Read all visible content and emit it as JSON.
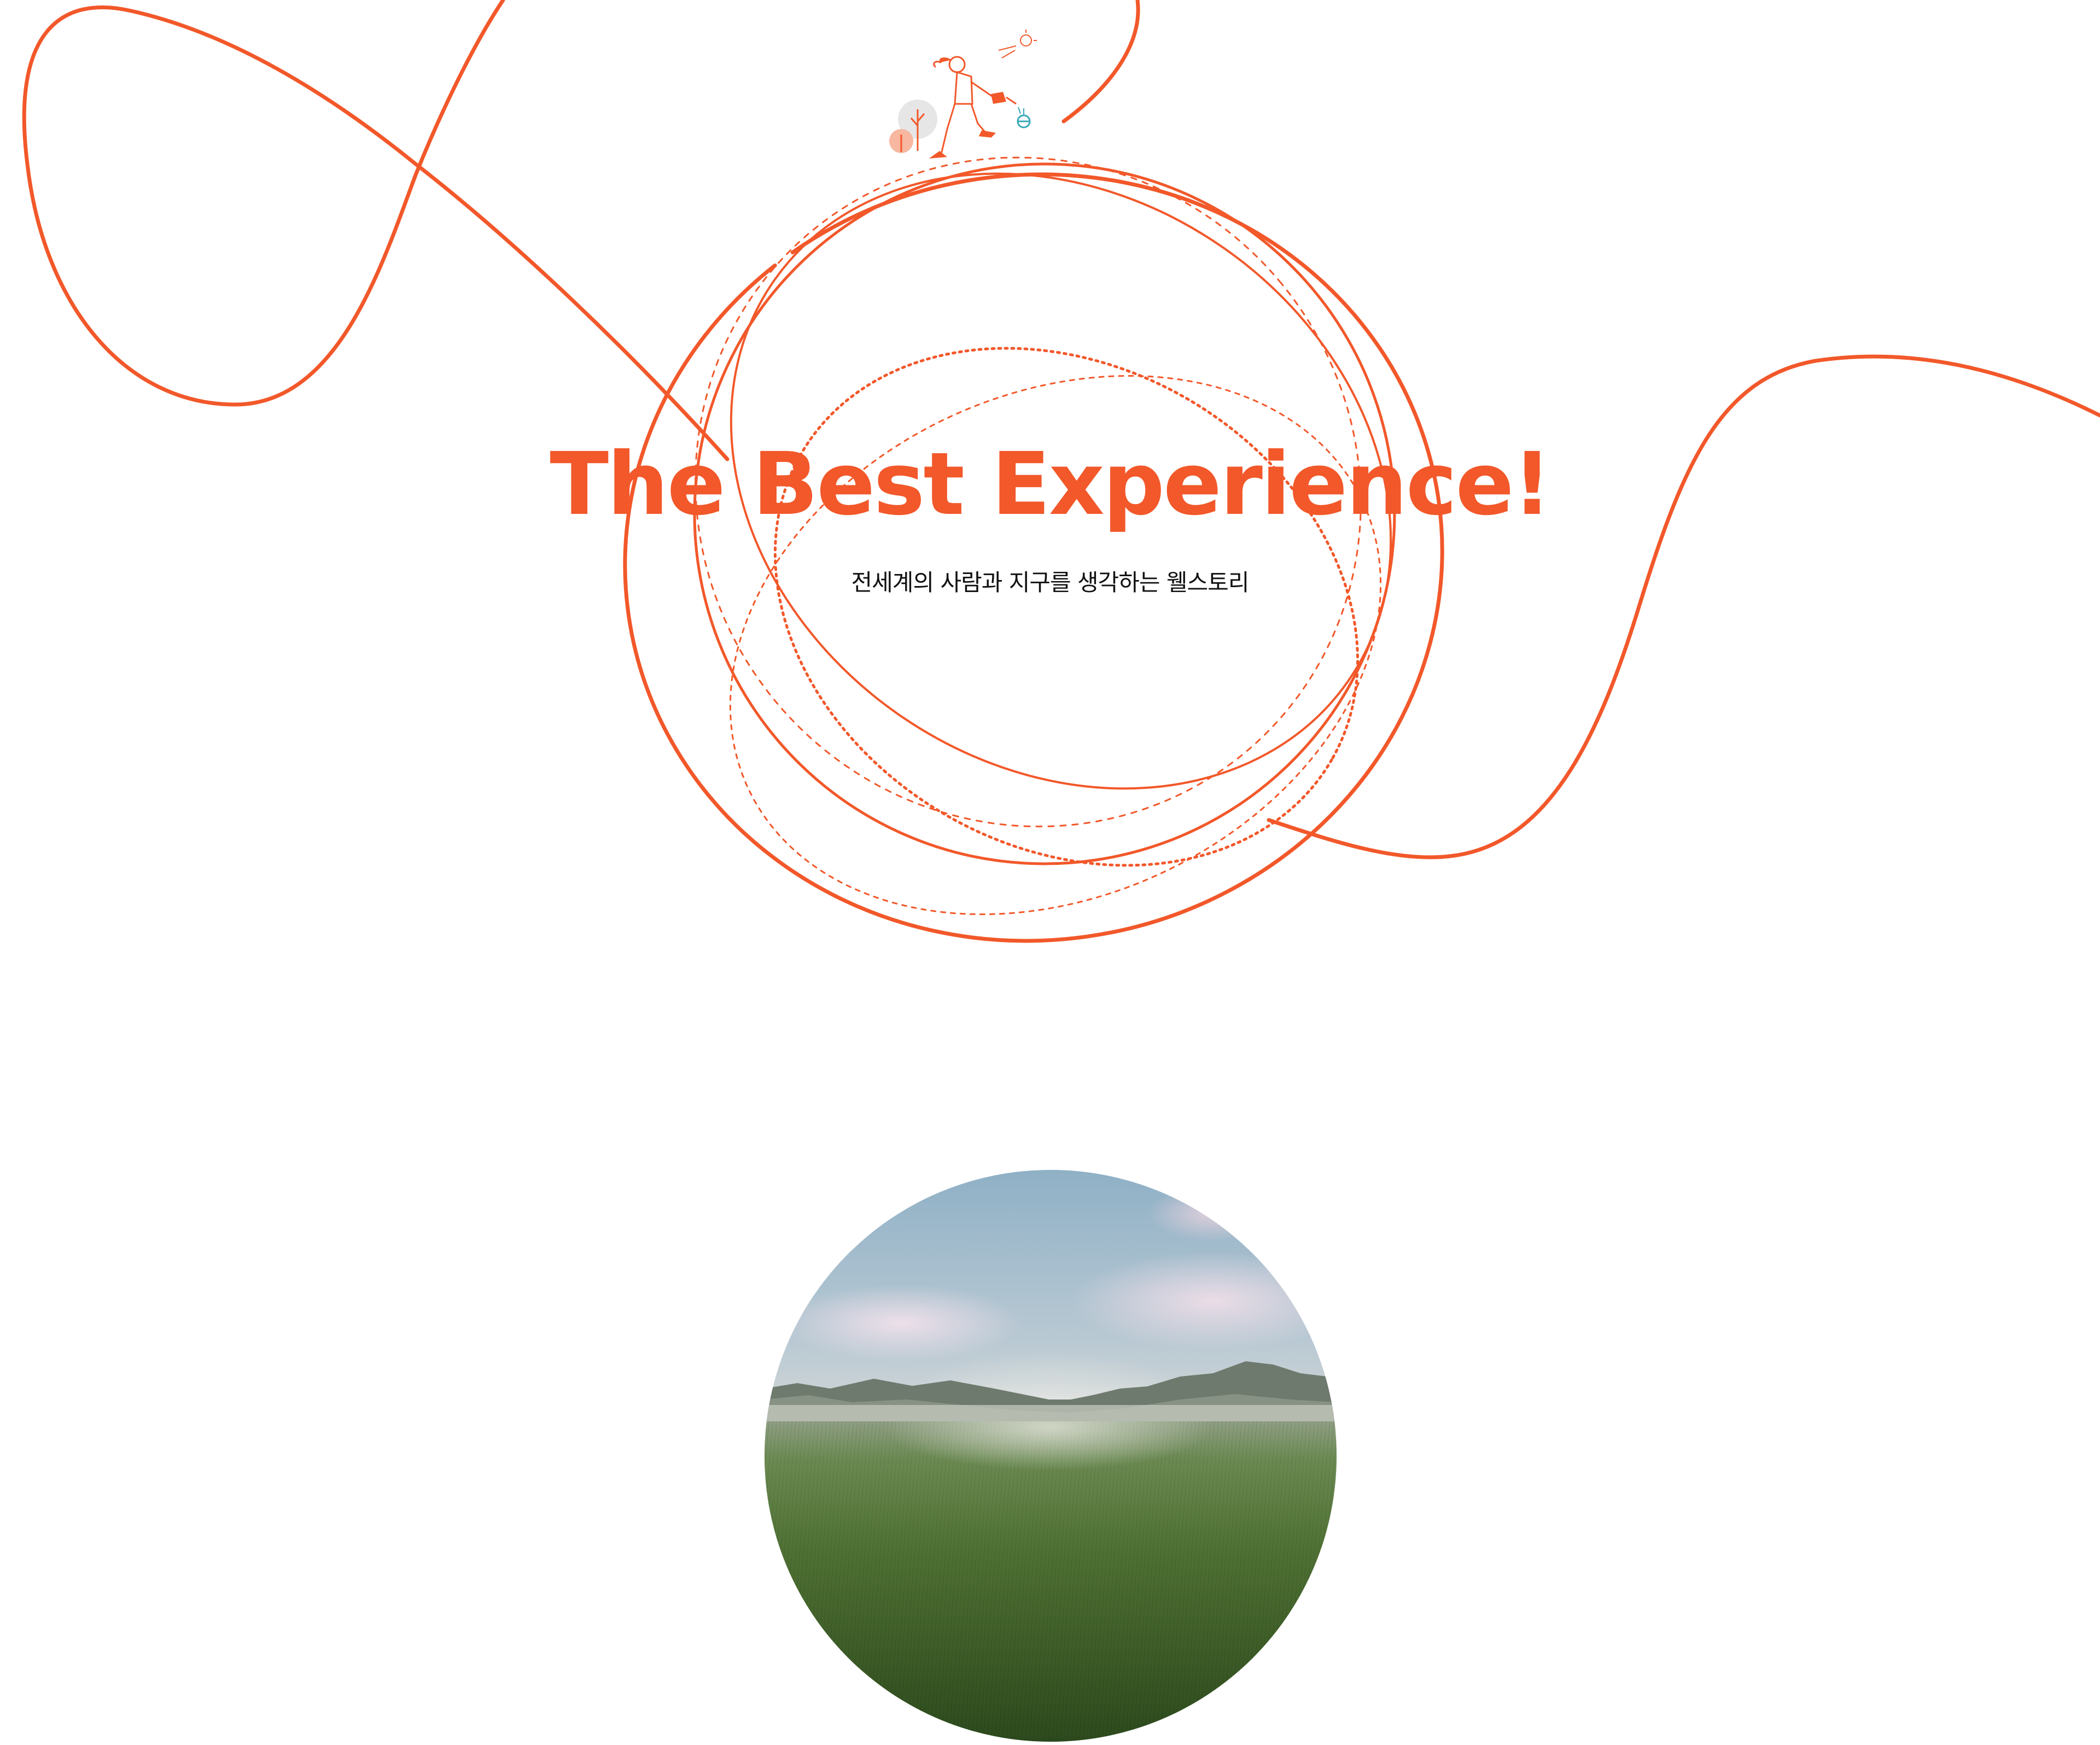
{
  "hero": {
    "title": "The Best Experience!",
    "subtitle": "전세계의 사람과 지구를 생각하는 웰스토리"
  },
  "colors": {
    "accent": "#f2582a",
    "text": "#111111",
    "background": "#ffffff"
  },
  "icons": {
    "illustration": "woman-watering-plant-icon",
    "tree": "tree-icon",
    "sun": "sun-icon",
    "flower": "flower-icon"
  }
}
